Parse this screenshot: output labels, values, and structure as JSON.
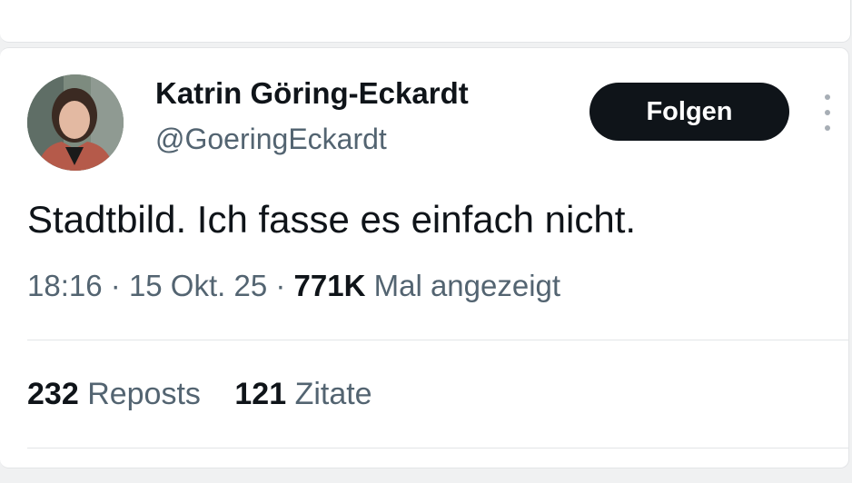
{
  "author": {
    "display_name": "Katrin Göring-Eckardt",
    "handle": "@GoeringEckardt"
  },
  "actions": {
    "follow_label": "Folgen",
    "more_icon": "more-vertical-icon"
  },
  "tweet": {
    "text": "Stadtbild. Ich fasse es einfach nicht.",
    "time": "18:16",
    "separator": "·",
    "date": "15 Okt. 25",
    "views_count": "771K",
    "views_label": "Mal angezeigt"
  },
  "stats": {
    "reposts_count": "232",
    "reposts_label": "Reposts",
    "quotes_count": "121",
    "quotes_label": "Zitate"
  },
  "colors": {
    "text_primary": "#0f1419",
    "text_secondary": "#536471",
    "button_bg": "#0f1419",
    "divider": "#e3e5e7",
    "page_bg": "#f0f1f2"
  }
}
